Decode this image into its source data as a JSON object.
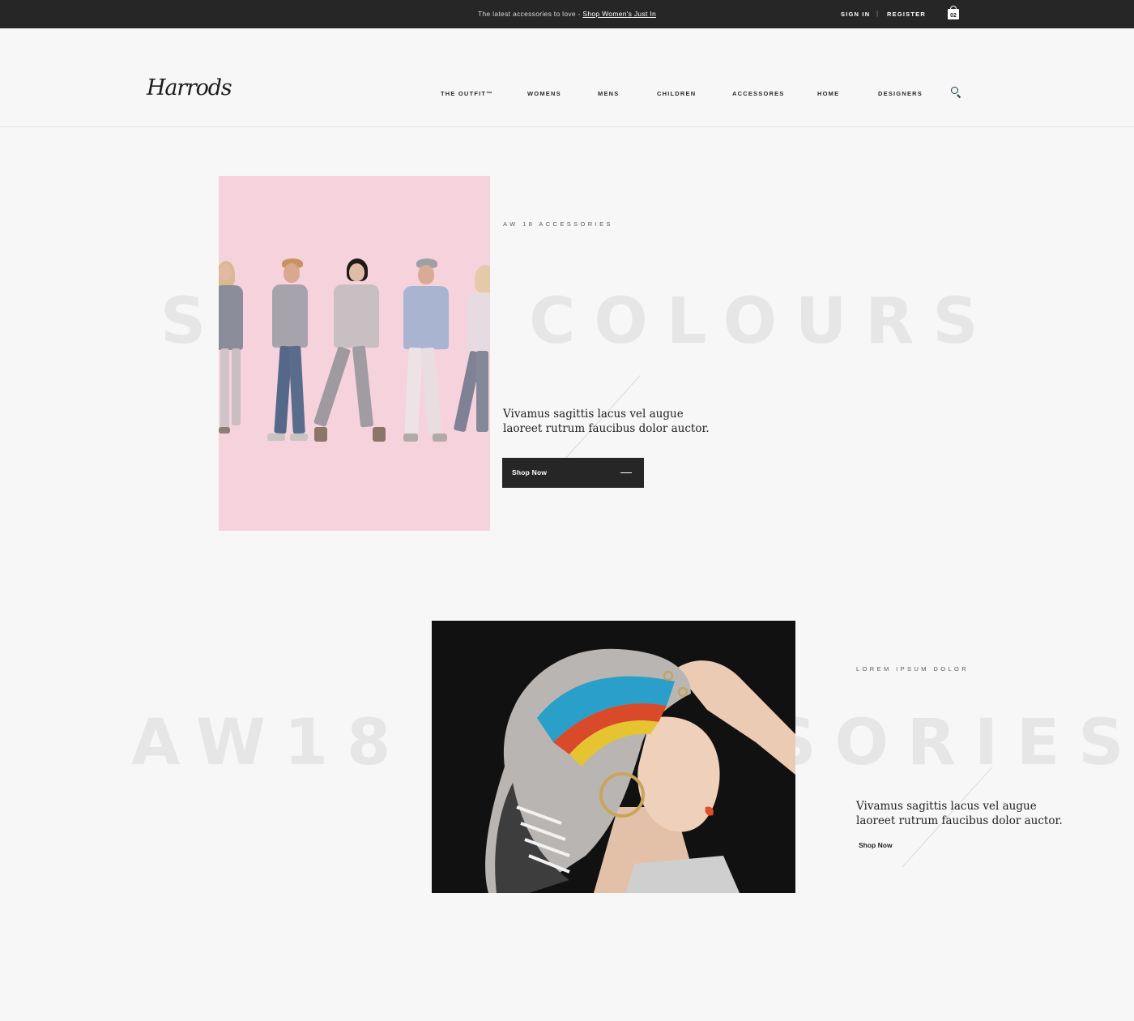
{
  "topbar": {
    "promo_text": "The latest accessories to love - ",
    "promo_link": "Shop Women's Just In",
    "sign_in": "SIGN IN",
    "separator": "|",
    "register": "REGISTER",
    "bag_count": "02",
    "bag_icon": "shopping-bag-icon"
  },
  "header": {
    "logo": "Harrods",
    "nav": [
      "THE OUTFIT™",
      "WOMENS",
      "MENS",
      "CHILDREN",
      "ACCESSORES",
      "HOME",
      "DESIGNERS"
    ],
    "search_icon": "search-icon"
  },
  "section1": {
    "background_word": "SUPER COLOURS",
    "eyebrow": "AW 18 ACCESSORIES",
    "lede_line1": "Vivamus sagittis lacus vel augue",
    "lede_line2": "laoreet rutrum faucibus dolor auctor.",
    "cta": "Shop Now",
    "image_bg": "#f6d2dd"
  },
  "section2": {
    "background_word": "AW18 ACCESSORIES",
    "eyebrow": "LOREM IPSUM DOLOR",
    "lede_line1": "Vivamus sagittis lacus vel augue",
    "lede_line2": "laoreet rutrum faucibus dolor auctor.",
    "cta": "Shop Now"
  }
}
